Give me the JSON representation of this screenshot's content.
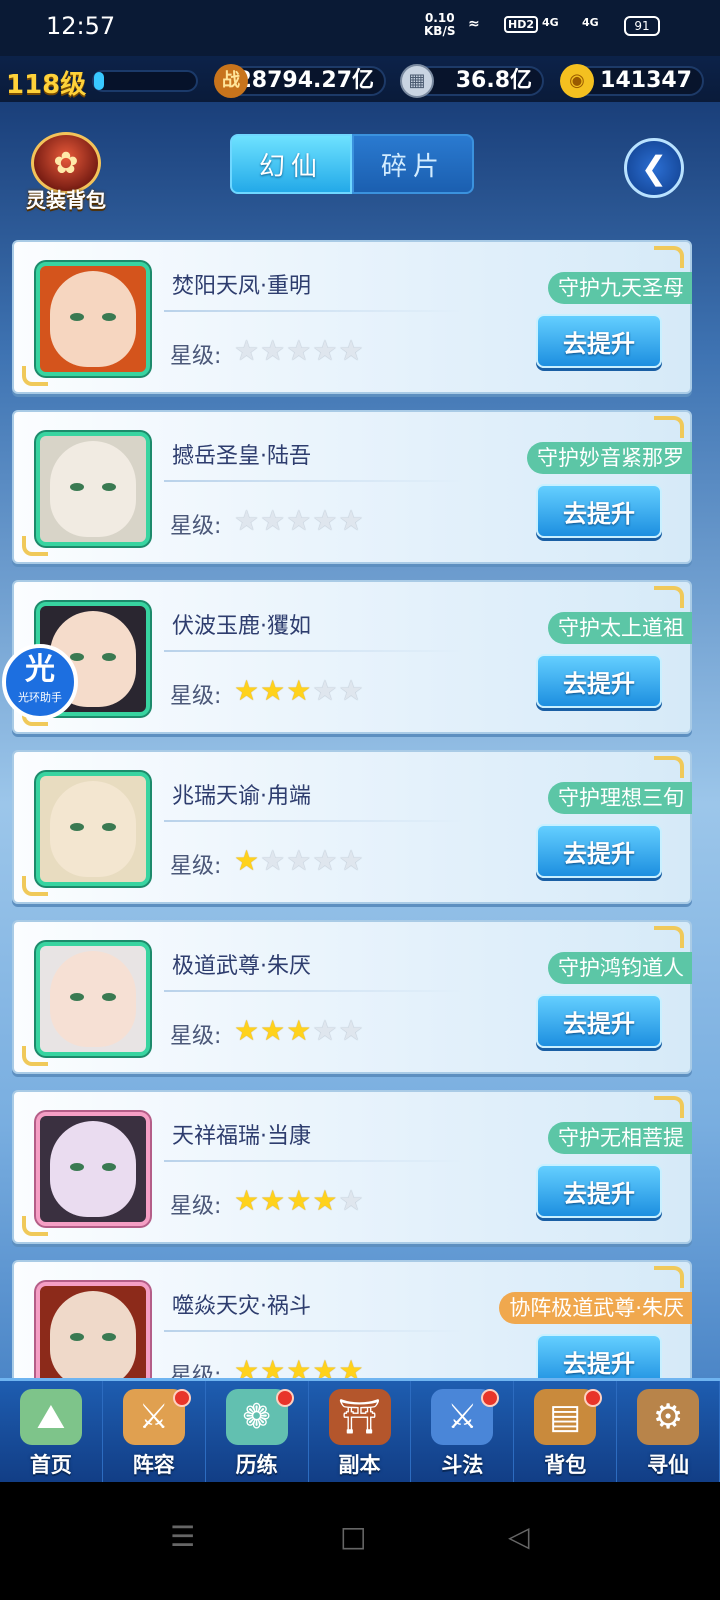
{
  "status_bar": {
    "time": "12:57",
    "net_speed": "0.10",
    "net_unit": "KB/S",
    "hd": "HD2",
    "sig1": "4G",
    "sig2": "4G",
    "battery": "91"
  },
  "resources": {
    "level": "118级",
    "exp_fraction": 0.1,
    "power_icon": "战",
    "power": "28794.27亿",
    "coin": "36.8亿",
    "gold": "141347"
  },
  "header": {
    "bag_label": "灵装背包",
    "tabs": [
      {
        "label": "幻仙",
        "active": true
      },
      {
        "label": "碎片",
        "active": false
      }
    ]
  },
  "list": {
    "star_label": "星级:",
    "button_label": "去提升",
    "items": [
      {
        "name": "焚阳天凤·重明",
        "stars": 0,
        "guard": "守护九天圣母",
        "guard_color": "green",
        "frame": "green"
      },
      {
        "name": "撼岳圣皇·陆吾",
        "stars": 0,
        "guard": "守护妙音紧那罗",
        "guard_color": "green",
        "frame": "green"
      },
      {
        "name": "伏波玉鹿·玃如",
        "stars": 3,
        "guard": "守护太上道祖",
        "guard_color": "green",
        "frame": "green"
      },
      {
        "name": "兆瑞天谕·甪端",
        "stars": 1,
        "guard": "守护理想三旬",
        "guard_color": "green",
        "frame": "green"
      },
      {
        "name": "极道武尊·朱厌",
        "stars": 3,
        "guard": "守护鸿钧道人",
        "guard_color": "green",
        "frame": "green"
      },
      {
        "name": "天祥福瑞·当康",
        "stars": 4,
        "guard": "守护无相菩提",
        "guard_color": "green",
        "frame": "pink"
      },
      {
        "name": "噬焱天灾·祸斗",
        "stars": 5,
        "guard": "协阵极道武尊·朱厌",
        "guard_color": "orange",
        "frame": "pink"
      }
    ]
  },
  "helper": {
    "glyph": "光",
    "label": "光环助手"
  },
  "bottom_nav": [
    {
      "label": "首页",
      "icon": "home-icon",
      "badge": false
    },
    {
      "label": "阵容",
      "icon": "lineup-icon",
      "badge": true
    },
    {
      "label": "历练",
      "icon": "training-icon",
      "badge": true
    },
    {
      "label": "副本",
      "icon": "dungeon-icon",
      "badge": false
    },
    {
      "label": "斗法",
      "icon": "battle-icon",
      "badge": true
    },
    {
      "label": "背包",
      "icon": "backpack-icon",
      "badge": true
    },
    {
      "label": "寻仙",
      "icon": "search-immortal-icon",
      "badge": false
    }
  ]
}
